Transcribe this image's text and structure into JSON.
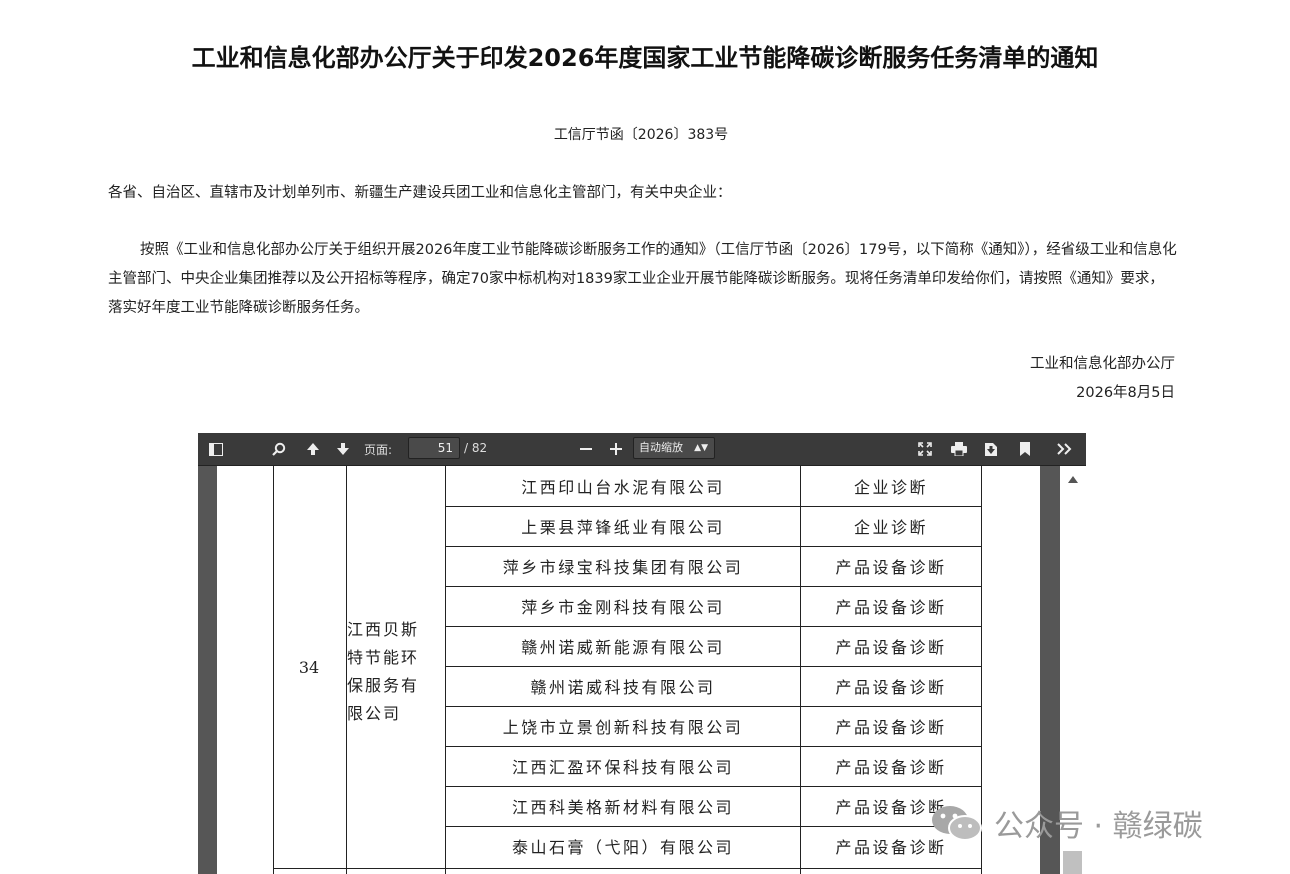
{
  "document": {
    "title": "工业和信息化部办公厅关于印发2026年度国家工业节能降碳诊断服务任务清单的通知",
    "doc_number": "工信厅节函〔2026〕383号",
    "salutation": "各省、自治区、直辖市及计划单列市、新疆生产建设兵团工业和信息化主管部门，有关中央企业：",
    "body": "按照《工业和信息化部办公厅关于组织开展2026年度工业节能降碳诊断服务工作的通知》（工信厅节函〔2026〕179号，以下简称《通知》），经省级工业和信息化主管部门、中央企业集团推荐以及公开招标等程序，确定70家中标机构对1839家工业企业开展节能降碳诊断服务。现将任务清单印发给你们，请按照《通知》要求，落实好年度工业节能降碳诊断服务任务。",
    "signature_org": "工业和信息化部办公厅",
    "signature_date": "2026年8月5日"
  },
  "viewer": {
    "page_label": "页面:",
    "current_page": "51",
    "total_pages": "/ 82",
    "zoom_label": "自动缩放"
  },
  "table": {
    "row_no": "34",
    "org": "江西贝斯特节能环保服务有限公司",
    "org_lines": [
      "江西贝斯",
      "特节能环",
      "保服务有",
      "限公司"
    ],
    "rows": [
      {
        "company": "江西印山台水泥有限公司",
        "type": "企业诊断"
      },
      {
        "company": "上栗县萍锋纸业有限公司",
        "type": "企业诊断"
      },
      {
        "company": "萍乡市绿宝科技集团有限公司",
        "type": "产品设备诊断"
      },
      {
        "company": "萍乡市金刚科技有限公司",
        "type": "产品设备诊断"
      },
      {
        "company": "赣州诺威新能源有限公司",
        "type": "产品设备诊断"
      },
      {
        "company": "赣州诺威科技有限公司",
        "type": "产品设备诊断"
      },
      {
        "company": "上饶市立景创新科技有限公司",
        "type": "产品设备诊断"
      },
      {
        "company": "江西汇盈环保科技有限公司",
        "type": "产品设备诊断"
      },
      {
        "company": "江西科美格新材料有限公司",
        "type": "产品设备诊断"
      },
      {
        "company": "泰山石膏（弋阳）有限公司",
        "type": "产品设备诊断"
      }
    ]
  },
  "watermark": {
    "text": "公众号 · 赣绿碳"
  }
}
